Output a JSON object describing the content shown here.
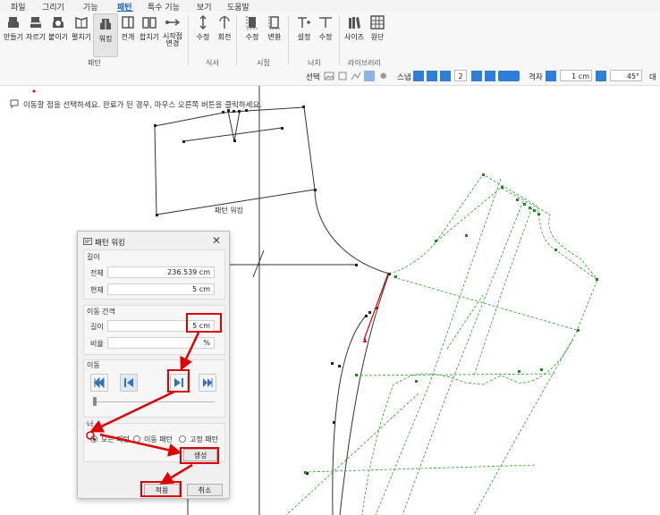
{
  "menu": [
    "파일",
    "그리기",
    "기능",
    "패턴",
    "특수 기능",
    "보기",
    "도움말"
  ],
  "ribbon": {
    "pattern_tools": [
      "만들기",
      "자르기",
      "붙이기",
      "펼치기",
      "워킹",
      "전개",
      "합치기",
      "시작점 변경"
    ],
    "pattern_group": "패턴",
    "dart_tools": [
      "수정",
      "회전"
    ],
    "dart_group": "식서",
    "seam_tools": [
      "수정",
      "변환"
    ],
    "seam_group": "시접",
    "notch_tools": [
      "설정",
      "수정"
    ],
    "notch_group": "너치",
    "library_tools": [
      "사이즈",
      "원단"
    ],
    "library_group": "라이브러리"
  },
  "propbar": {
    "select_label": "선택",
    "snap_label": "스냅",
    "snap_value": "2",
    "grid_label": "격자",
    "grid_size": "1 cm",
    "angle": "45°",
    "cut_label": "대"
  },
  "instruction": "이동할 점을 선택하세요. 완료가 된 경우, 마우스 오른쪽 버튼을 클릭하세요.",
  "canvas_label": "패턴 워킹",
  "dialog": {
    "title": "패턴 워킹",
    "length_section": "길이",
    "total_label": "전체",
    "total_value": "236.539  cm",
    "current_label": "현재",
    "current_value": "5  cm",
    "interval_section": "이동 간격",
    "interval_length_label": "길이",
    "interval_length_value": "5  cm",
    "ratio_label": "비율",
    "ratio_value": "%",
    "move_section": "이동",
    "target_section": "너",
    "radio_all": "모든 패턴",
    "radio_moving": "이동 패턴",
    "radio_fixed": "고정 패턴",
    "create_button": "생성",
    "apply_button": "적용",
    "cancel_button": "취소"
  },
  "colors": {
    "accent": "#1565c0",
    "highlight": "#e00000",
    "pattern_green": "#2e9e2e"
  }
}
